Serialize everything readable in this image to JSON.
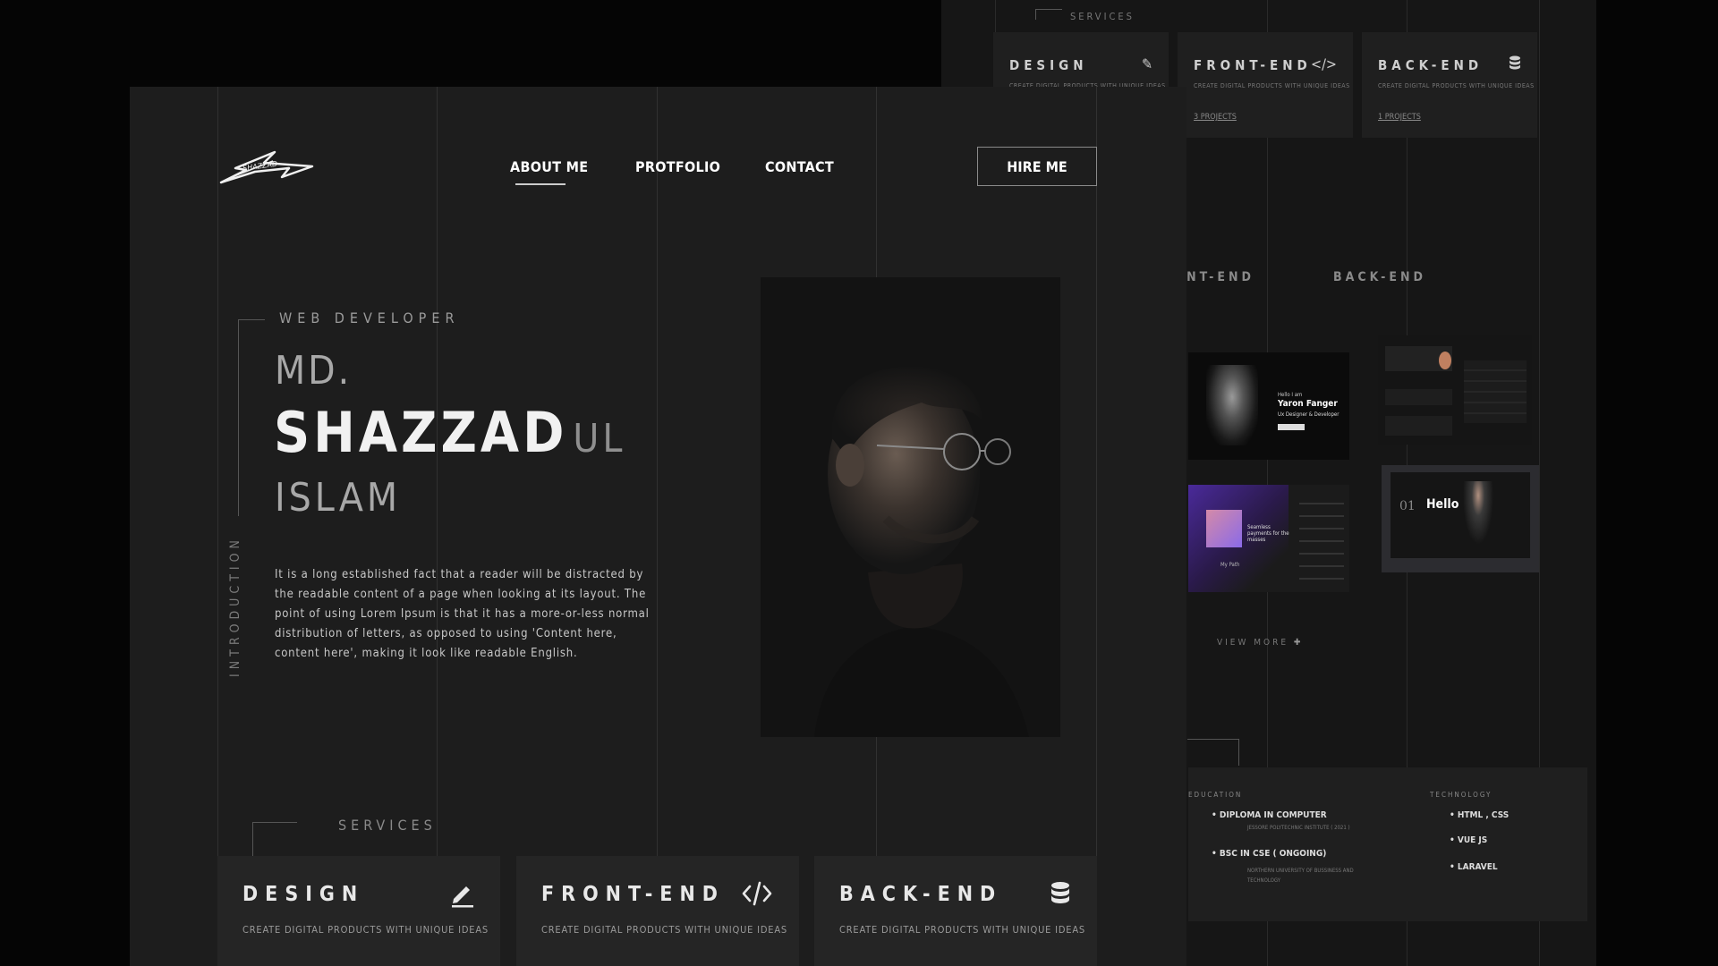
{
  "bg": {
    "services_label": "SERVICES",
    "cards": [
      {
        "title": "DESIGN",
        "subtitle": "CREATE DIGITAL PRODUCTS WITH UNIQUE IDEAS",
        "projects": ""
      },
      {
        "title": "FRONT-END",
        "subtitle": "CREATE DIGITAL PRODUCTS WITH UNIQUE IDEAS",
        "projects": "3 PROJECTS"
      },
      {
        "title": "BACK-END",
        "subtitle": "CREATE DIGITAL PRODUCTS WITH UNIQUE IDEAS",
        "projects": "1 PROJECTS"
      }
    ],
    "tabs": {
      "frontend": "FRONT-END",
      "backend": "BACK-END"
    },
    "thumbs": {
      "t1_line1": "Hello I am",
      "t1_name": "Yaron Fanger",
      "t1_role": "Ux Designer & Developer",
      "t3_heading": "Seamless payments for the masses",
      "t3_footer": "My Path",
      "t4_num": "01",
      "t4_hello": "Hello"
    },
    "view_more": "VIEW MORE",
    "education_label": "EDUCATION",
    "technology_label": "TECHNOLOGY",
    "education": [
      {
        "degree": "DIPLOMA IN COMPUTER",
        "school": "JESSORE POLYTECHNIC INSTITUTE ( 2021 )"
      },
      {
        "degree": "BSC IN CSE ( ONGOING)",
        "school": "NORTHERN UNIVERSITY OF BUSSINESS AND TECHNOLOGY"
      }
    ],
    "technology": [
      "HTML , CSS",
      "VUE JS",
      "LARAVEL"
    ]
  },
  "main": {
    "logo_text": "SHAZZAD",
    "nav": {
      "about": "ABOUT ME",
      "portfolio": "PROTFOLIO",
      "contact": "CONTACT"
    },
    "hire": "HIRE ME",
    "role": "WEB DEVELOPER",
    "name_first": "MD.",
    "name_bold": "SHAZZAD",
    "name_suffix": "UL",
    "name_last": "ISLAM",
    "intro_label": "INTRODUCTION",
    "bio": "It is a long established fact that a reader will be distracted by the readable content of a page when looking at its layout. The point of using Lorem Ipsum is that it has a more-or-less normal distribution of letters, as opposed to using 'Content here, content here', making it look like readable English.",
    "services_label": "SERVICES",
    "services": [
      {
        "title": "DESIGN",
        "subtitle": "CREATE DIGITAL PRODUCTS WITH UNIQUE IDEAS",
        "icon": "pencil-icon"
      },
      {
        "title": "FRONT-END",
        "subtitle": "CREATE DIGITAL PRODUCTS WITH UNIQUE IDEAS",
        "icon": "code-icon"
      },
      {
        "title": "BACK-END",
        "subtitle": "CREATE DIGITAL PRODUCTS WITH UNIQUE IDEAS",
        "icon": "database-icon"
      }
    ]
  }
}
